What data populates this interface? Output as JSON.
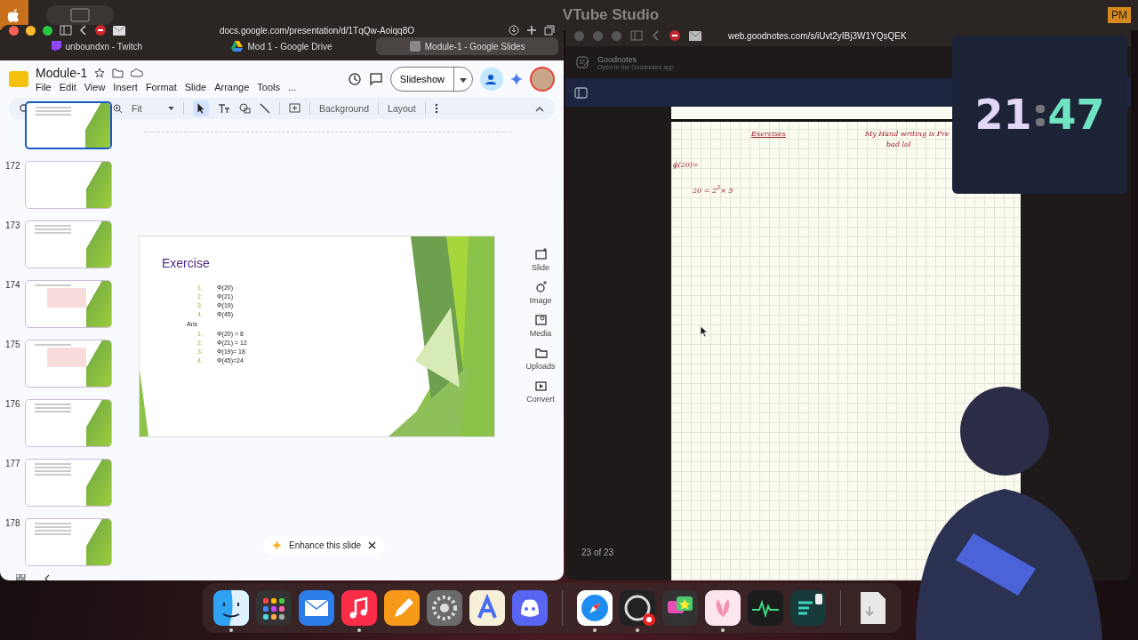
{
  "menu_bar": {
    "app_title": "VTube Studio",
    "time_suffix": "PM"
  },
  "slides_window": {
    "url": "docs.google.com/presentation/d/1TqQw-Aoiqq8O",
    "tabs": [
      {
        "label": "unboundxn - Twitch",
        "kind": "twitch",
        "selected": false
      },
      {
        "label": "Mod 1 - Google Drive",
        "kind": "drive",
        "selected": false
      },
      {
        "label": "Module-1 - Google Slides",
        "kind": "slides",
        "selected": true
      }
    ],
    "doc_title": "Module-1",
    "menus": [
      "File",
      "Edit",
      "View",
      "Insert",
      "Format",
      "Slide",
      "Arrange",
      "Tools",
      "..."
    ],
    "slideshow": "Slideshow",
    "zoom": "Fit",
    "toolbar_buttons": [
      "Background",
      "Layout"
    ],
    "thumbnails": [
      {
        "selected": true,
        "kind": "list"
      },
      {
        "number": "172",
        "kind": "title",
        "selected": false
      },
      {
        "number": "173",
        "kind": "text",
        "selected": false
      },
      {
        "number": "174",
        "kind": "box",
        "selected": false
      },
      {
        "number": "175",
        "kind": "box",
        "selected": false
      },
      {
        "number": "176",
        "kind": "text",
        "selected": false
      },
      {
        "number": "177",
        "kind": "dense",
        "selected": false
      },
      {
        "number": "178",
        "kind": "dense",
        "selected": false
      }
    ],
    "slide": {
      "title": "Exercise",
      "questions": [
        {
          "marker": "1.",
          "text": "Φ(20)"
        },
        {
          "marker": "2.",
          "text": "Φ(21)"
        },
        {
          "marker": "3.",
          "text": "Φ(19)"
        },
        {
          "marker": "4.",
          "text": "Φ(45)"
        }
      ],
      "answer_label": "Ans",
      "answers": [
        {
          "marker": "1.",
          "text": "Φ(20) = 8"
        },
        {
          "marker": "2.",
          "text": "Φ(21) = 12"
        },
        {
          "marker": "3.",
          "text": "Φ(19)= 18"
        },
        {
          "marker": "4.",
          "text": "Φ(45)=24"
        }
      ]
    },
    "side_panel": [
      {
        "label": "Slide",
        "kind": "slide"
      },
      {
        "label": "Image",
        "kind": "image"
      },
      {
        "label": "Media",
        "kind": "media"
      },
      {
        "label": "Uploads",
        "kind": "uploads"
      },
      {
        "label": "Convert",
        "kind": "convert"
      }
    ],
    "enhance": "Enhance this slide"
  },
  "notes_window": {
    "url": "web.goodnotes.com/s/iUvt2yIBj3W1YQsQEK",
    "app_name": "Goodnotes",
    "app_hint": "Open in the Goodnotes app",
    "page_counter": "23 of 23",
    "handwriting": {
      "heading": "Exercises",
      "remark_line_1": "My Hand writing is Pre",
      "remark_line_2": "bad lol",
      "expression": "ϕ(20)=",
      "factorization": "20 = 2$^{2}$× 5"
    }
  },
  "clock_widget": {
    "hours": "21",
    "minutes": "47"
  },
  "dock": [
    {
      "kind": "finder",
      "running": true
    },
    {
      "kind": "launchpad",
      "running": false
    },
    {
      "kind": "mail",
      "running": false
    },
    {
      "kind": "music",
      "running": true
    },
    {
      "kind": "pages",
      "running": false
    },
    {
      "kind": "settings",
      "running": false
    },
    {
      "kind": "letter",
      "running": false
    },
    {
      "kind": "discord",
      "running": false
    },
    {
      "kind": "separator"
    },
    {
      "kind": "safari",
      "running": true
    },
    {
      "kind": "obs",
      "running": true
    },
    {
      "kind": "chat",
      "running": false
    },
    {
      "kind": "petal",
      "running": true
    },
    {
      "kind": "pulse",
      "running": false
    },
    {
      "kind": "script",
      "running": false
    },
    {
      "kind": "separator"
    },
    {
      "kind": "file",
      "running": false
    }
  ]
}
